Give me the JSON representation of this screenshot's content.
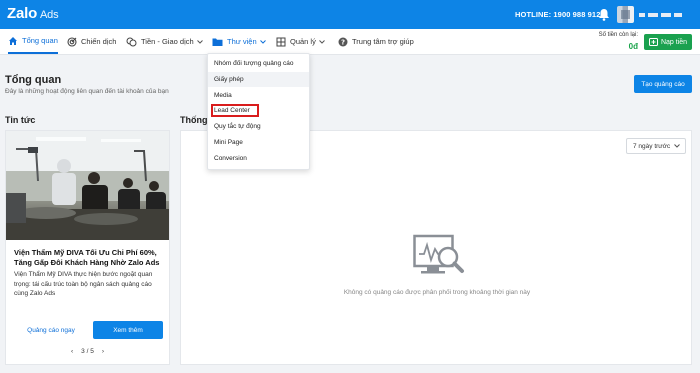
{
  "topbar": {
    "logo_main": "Zalo",
    "logo_sub": "Ads",
    "hotline": "HOTLINE: 1900 988 912"
  },
  "nav": {
    "items": [
      {
        "label": "Tổng quan",
        "icon": "home-icon"
      },
      {
        "label": "Chiến dịch",
        "icon": "target-icon"
      },
      {
        "label": "Tiền - Giao dịch",
        "icon": "money-icon"
      },
      {
        "label": "Thư viện",
        "icon": "folder-icon"
      },
      {
        "label": "Quản lý",
        "icon": "grid-icon"
      },
      {
        "label": "Trung tâm trợ giúp",
        "icon": "help-icon"
      }
    ],
    "balance_label": "Số tiền còn lại:",
    "balance_value": "0đ",
    "topup_label": "Nạp tiền"
  },
  "header": {
    "title": "Tổng quan",
    "subtitle": "Đây là những hoạt động liên quan đến tài khoản của bạn",
    "create_label": "Tạo quảng cáo"
  },
  "news": {
    "section_title": "Tin tức",
    "headline": "Viện Thẩm Mỹ DIVA Tối Ưu Chi Phí 60%, Tăng Gấp Đôi Khách Hàng Nhờ Zalo Ads",
    "body": "Viện Thẩm Mỹ DIVA thực hiện bước ngoặt quan trọng: tái cấu trúc toàn bộ ngân sách quảng cáo cùng Zalo Ads",
    "link_label": "Quảng cáo ngay",
    "more_label": "Xem thêm",
    "page": "3 / 5"
  },
  "stats": {
    "section_title": "Thống kê",
    "range_label": "7 ngày trước",
    "empty_text": "Không có quảng cáo được phân phối trong khoảng thời gian này"
  },
  "dropdown": {
    "items": [
      "Nhóm đối tượng quảng cáo",
      "Giấy phép",
      "Media",
      "Lead Center",
      "Quy tắc tự động",
      "Mini Page",
      "Conversion"
    ]
  },
  "colors": {
    "brand": "#0d84e6",
    "topup": "#1aa14f",
    "balance": "#19a34a",
    "highlight": "#d91c1c"
  }
}
